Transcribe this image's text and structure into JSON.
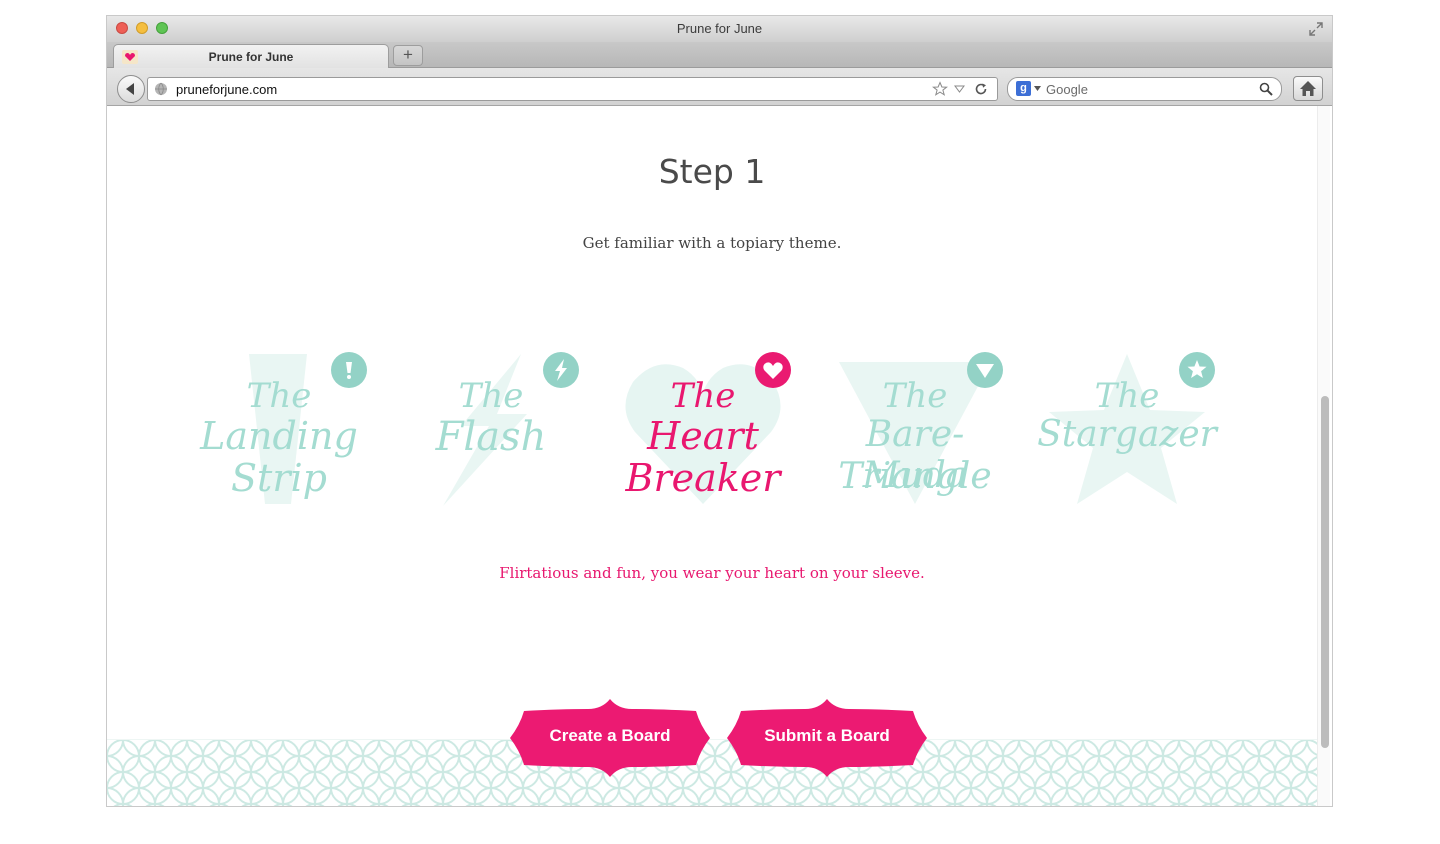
{
  "window": {
    "title": "Prune for June"
  },
  "tabs": [
    {
      "label": "Prune for June",
      "active": true
    }
  ],
  "new_tab_label": "+",
  "address_bar": {
    "url": "pruneforjune.com"
  },
  "search_bar": {
    "placeholder": "Google",
    "engine_icon": "google-icon"
  },
  "page": {
    "step_title": "Step 1",
    "step_subtitle": "Get familiar with a topiary theme.",
    "themes": [
      {
        "line1": "The",
        "line2": "Landing",
        "line3": "Strip",
        "icon": "exclamation-icon",
        "active": false
      },
      {
        "line1": "The",
        "line2": "Flash",
        "line3": "",
        "icon": "lightning-icon",
        "active": false
      },
      {
        "line1": "The",
        "line2": "Heart",
        "line3": "Breaker",
        "icon": "heart-icon",
        "active": true
      },
      {
        "line1": "The",
        "line2": "Bare-Muda",
        "line3": "Triangle",
        "icon": "triangle-icon",
        "active": false
      },
      {
        "line1": "The",
        "line2": "Stargazer",
        "line3": "",
        "icon": "star-icon",
        "active": false
      }
    ],
    "active_description": "Flirtatious and fun, you wear your heart on your sleeve.",
    "buttons": {
      "create": "Create a Board",
      "submit": "Submit a Board"
    }
  },
  "colors": {
    "accent_pink": "#e9176f",
    "mint": "#a4dcd1",
    "mint_badge": "#93d2c6",
    "pattern": "#cde9e3"
  }
}
